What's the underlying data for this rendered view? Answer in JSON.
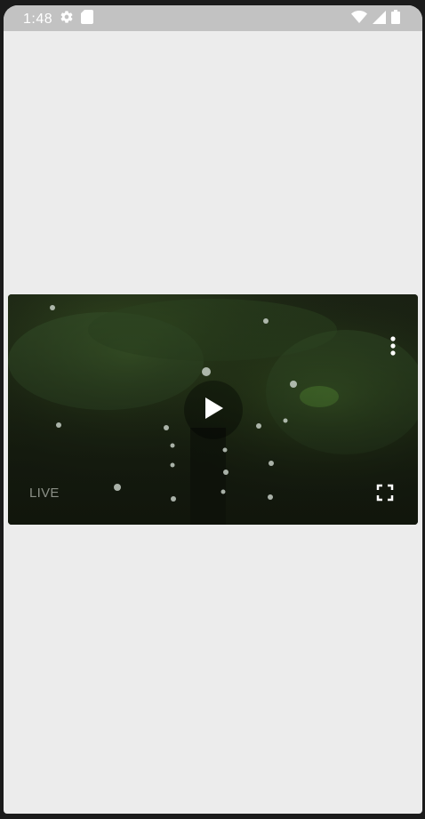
{
  "status_bar": {
    "time": "1:48",
    "icons": [
      "settings-gear-icon",
      "sd-card-icon",
      "wifi-icon",
      "cell-signal-icon",
      "battery-icon"
    ]
  },
  "video_player": {
    "live_label": "LIVE",
    "controls": [
      "play-icon",
      "more-vert-icon",
      "fullscreen-icon"
    ]
  }
}
